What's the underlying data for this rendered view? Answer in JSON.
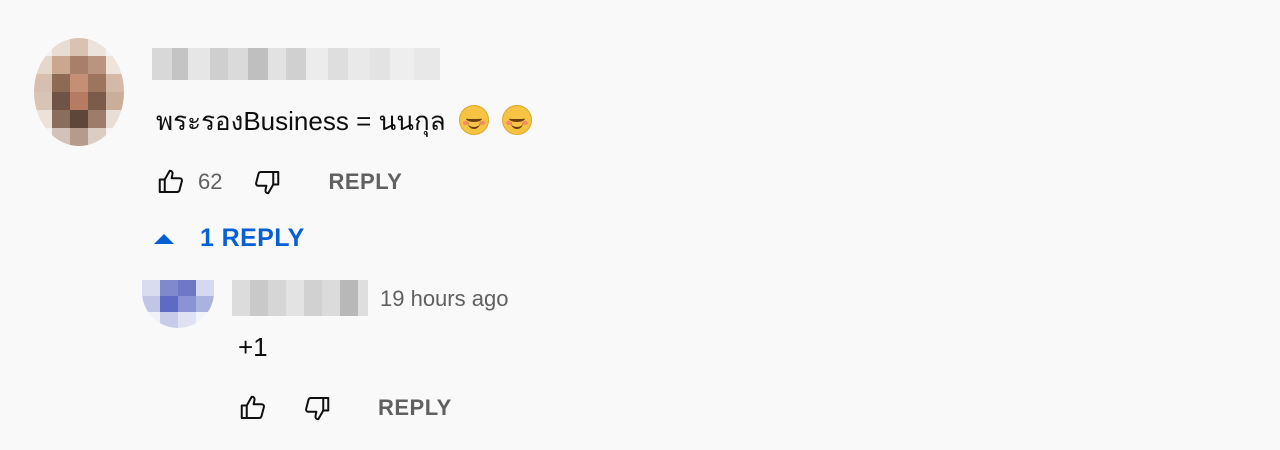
{
  "comment": {
    "text": "พระรองBusiness = นนกุล",
    "emojis": [
      "smiling-face-emoji",
      "smiling-face-emoji"
    ],
    "like_count": "62",
    "reply_label": "REPLY",
    "replies_toggle": "1 REPLY"
  },
  "reply": {
    "time": "19 hours ago",
    "text": "+1",
    "reply_label": "REPLY"
  },
  "colors": {
    "link_blue": "#065fd4",
    "secondary_text": "#606060",
    "background": "#f9f9f9"
  }
}
